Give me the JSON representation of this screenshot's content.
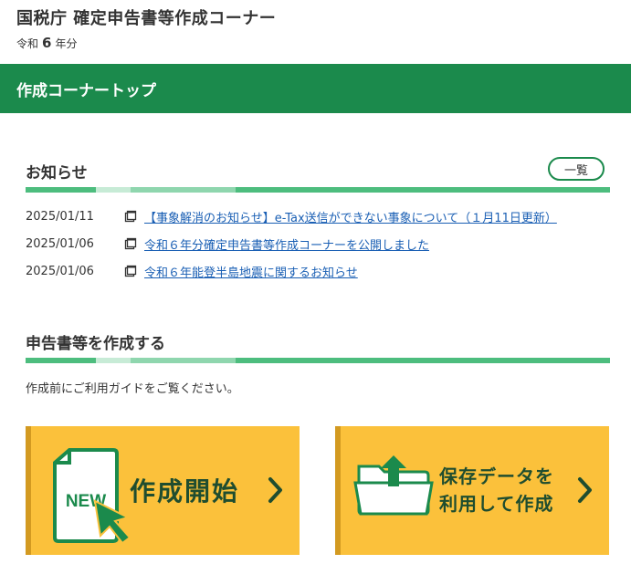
{
  "header": {
    "site_title": "国税庁 確定申告書等作成コーナー",
    "year_prefix": "令和",
    "year_number": "6",
    "year_suffix": "年分"
  },
  "nav": {
    "current_page": "作成コーナートップ"
  },
  "news": {
    "title": "お知らせ",
    "list_all_label": "一覧",
    "items": [
      {
        "date": "2025/01/11",
        "text": "【事象解消のお知らせ】e-Tax送信ができない事象について（１月11日更新）"
      },
      {
        "date": "2025/01/06",
        "text": "令和６年分確定申告書等作成コーナーを公開しました"
      },
      {
        "date": "2025/01/06",
        "text": "令和６年能登半島地震に関するお知らせ"
      }
    ]
  },
  "create": {
    "title": "申告書等を作成する",
    "guide": "作成前にご利用ガイドをご覧ください。",
    "start_card": {
      "badge": "NEW",
      "label": "作成開始"
    },
    "saved_card": {
      "line1": "保存データを",
      "line2": "利用して作成"
    }
  },
  "colors": {
    "brand_green": "#1b8a4c",
    "card_yellow": "#fbc13b",
    "link_blue": "#1a5fb4"
  },
  "icons": [
    "new-document-icon",
    "cursor-arrow-icon",
    "folder-upload-icon",
    "chevron-right-icon",
    "new-window-icon"
  ]
}
